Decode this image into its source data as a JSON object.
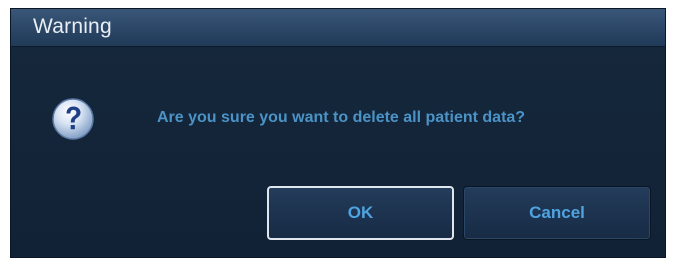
{
  "dialog": {
    "title": "Warning",
    "icon": "question-icon",
    "message": "Are you sure you want to delete all patient data?",
    "ok_label": "OK",
    "cancel_label": "Cancel"
  },
  "colors": {
    "title_bar": "#2b4666",
    "body_background": "#142437",
    "message_text": "#4b93c6",
    "button_text": "#4fa3e0",
    "focus_border": "#dfe6ee"
  }
}
